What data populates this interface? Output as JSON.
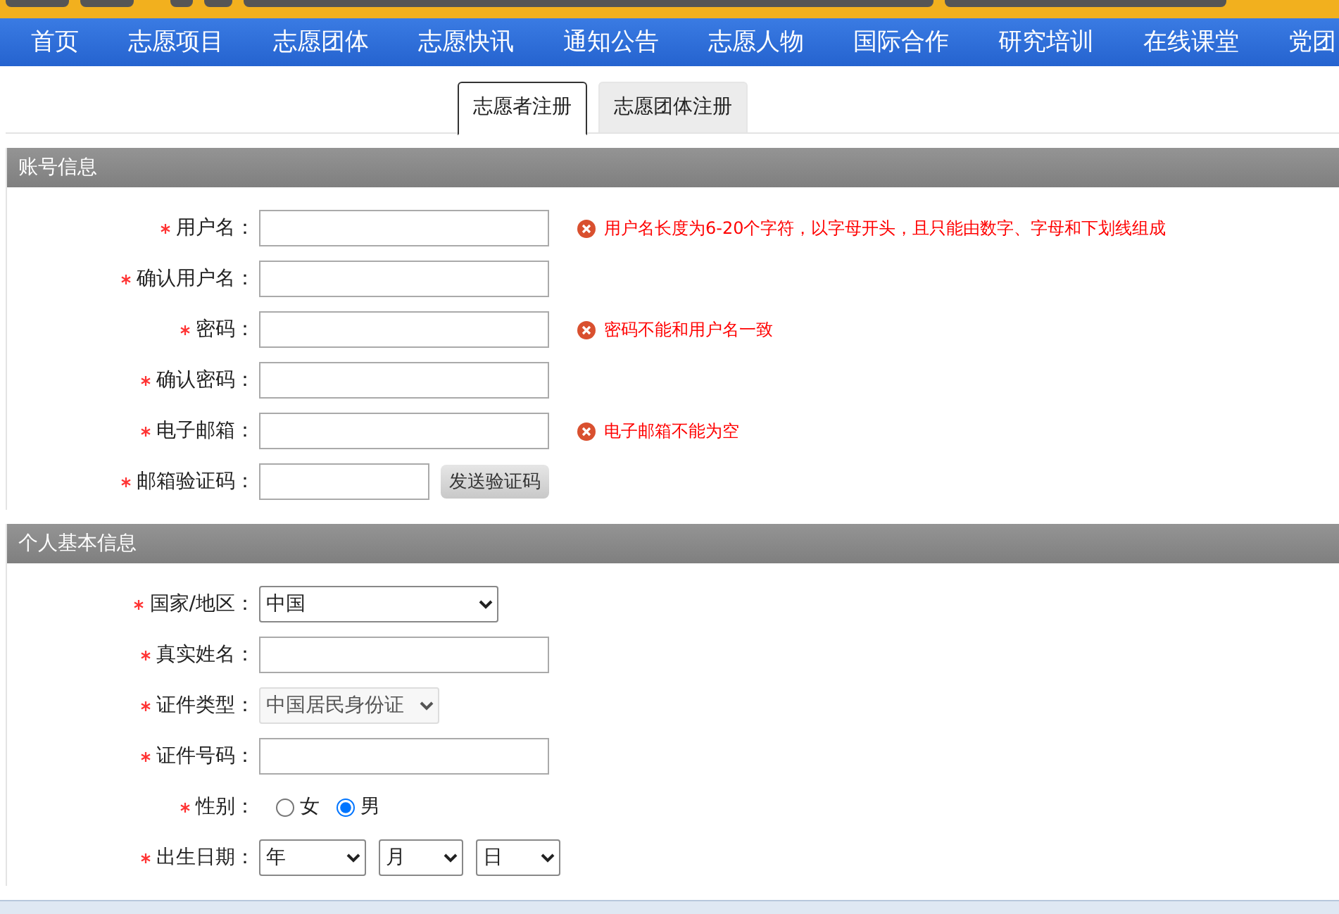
{
  "nav": {
    "items": [
      {
        "label": "首页"
      },
      {
        "label": "志愿项目"
      },
      {
        "label": "志愿团体"
      },
      {
        "label": "志愿快讯"
      },
      {
        "label": "通知公告"
      },
      {
        "label": "志愿人物"
      },
      {
        "label": "国际合作"
      },
      {
        "label": "研究培训"
      },
      {
        "label": "在线课堂"
      },
      {
        "label": "党团"
      }
    ]
  },
  "tabs": [
    {
      "label": "志愿者注册",
      "selected": true
    },
    {
      "label": "志愿团体注册",
      "selected": false
    }
  ],
  "sections": [
    {
      "title": "账号信息",
      "fields": [
        {
          "kind": "text",
          "label": "用户名：",
          "required": true,
          "error": "用户名长度为6-20个字符，以字母开头，且只能由数字、字母和下划线组成"
        },
        {
          "kind": "text",
          "label": "确认用户名：",
          "required": true
        },
        {
          "kind": "text",
          "label": "密码：",
          "required": true,
          "error": "密码不能和用户名一致"
        },
        {
          "kind": "text",
          "label": "确认密码：",
          "required": true
        },
        {
          "kind": "text",
          "label": "电子邮箱：",
          "required": true,
          "error": "电子邮箱不能为空"
        },
        {
          "kind": "code",
          "label": "邮箱验证码：",
          "required": true,
          "button": "发送验证码"
        }
      ]
    },
    {
      "title": "个人基本信息",
      "fields": [
        {
          "kind": "select",
          "label": "国家/地区：",
          "required": true,
          "value": "中国",
          "disabled": false
        },
        {
          "kind": "text",
          "label": "真实姓名：",
          "required": true
        },
        {
          "kind": "select",
          "label": "证件类型：",
          "required": true,
          "value": "中国居民身份证",
          "disabled": true
        },
        {
          "kind": "text",
          "label": "证件号码：",
          "required": true
        },
        {
          "kind": "radio",
          "label": "性别：",
          "required": true,
          "options": [
            {
              "label": "女",
              "selected": false
            },
            {
              "label": "男",
              "selected": true
            }
          ]
        },
        {
          "kind": "date",
          "label": "出生日期：",
          "required": true,
          "parts": [
            "年",
            "月",
            "日"
          ]
        }
      ]
    }
  ]
}
